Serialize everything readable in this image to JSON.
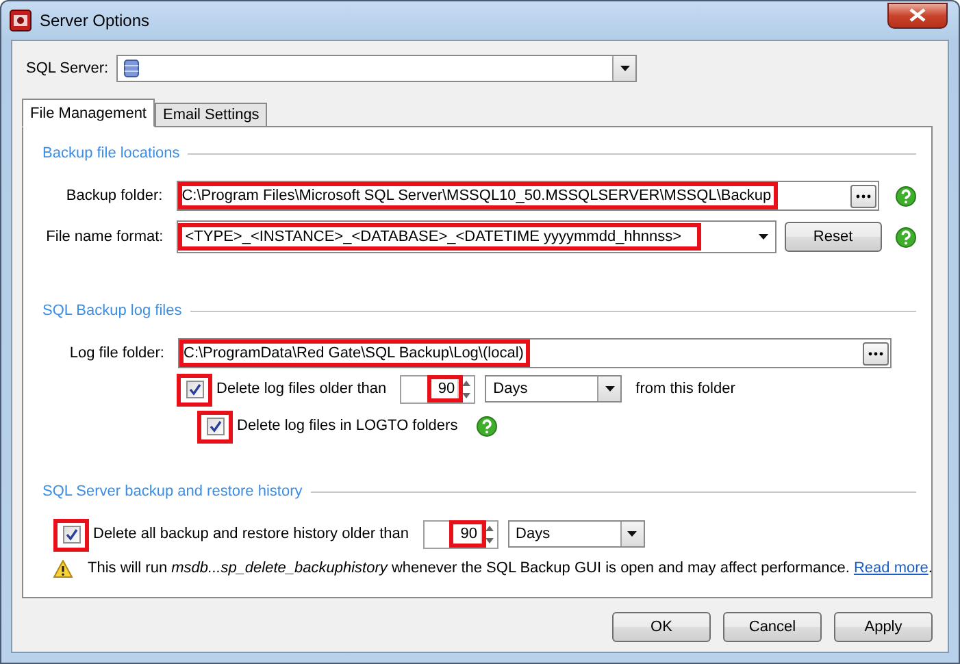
{
  "window": {
    "title": "Server Options"
  },
  "server": {
    "label": "SQL Server:"
  },
  "tabs": [
    {
      "label": "File Management",
      "selected": true
    },
    {
      "label": "Email Settings",
      "selected": false
    }
  ],
  "sections": [
    {
      "title": "Backup file locations",
      "rows": [
        {
          "kind": "folder",
          "label": "Backup folder:",
          "value": "C:\\Program Files\\Microsoft SQL Server\\MSSQL10_50.MSSQLSERVER\\MSSQL\\Backup",
          "highlighted": true,
          "help": true
        },
        {
          "kind": "format",
          "label": "File name format:",
          "value": "<TYPE>_<INSTANCE>_<DATABASE>_<DATETIME yyyymmdd_hhnnss>",
          "highlighted": true,
          "button": "Reset",
          "help": true
        }
      ]
    },
    {
      "title": "SQL Backup log files",
      "rows": [
        {
          "kind": "folder",
          "label": "Log file folder:",
          "value": "C:\\ProgramData\\Red Gate\\SQL Backup\\Log\\(local)",
          "highlighted": true,
          "help": false
        },
        {
          "kind": "retention",
          "label": "Delete log files older than",
          "checked": true,
          "highlighted": true,
          "amount": "90",
          "amount_highlighted": true,
          "unit": "Days",
          "suffix": "from this folder"
        },
        {
          "kind": "check",
          "label": "Delete log files in LOGTO folders",
          "checked": true,
          "highlighted": true,
          "help": true
        }
      ]
    },
    {
      "title": "SQL Server backup and restore history",
      "rows": [
        {
          "kind": "cleanup",
          "label": "Delete all backup and restore history older than",
          "checked": true,
          "highlighted": true,
          "amount": "90",
          "amount_highlighted": true,
          "unit": "Days"
        },
        {
          "kind": "warning",
          "text": "This will run *msdb...sp_delete_backuphistory* whenever the SQL Backup GUI is open and may affect performance.",
          "link": "Read more",
          "after": "."
        }
      ]
    }
  ],
  "buttons": [
    {
      "label": "OK"
    },
    {
      "label": "Cancel"
    },
    {
      "label": "Apply"
    }
  ]
}
